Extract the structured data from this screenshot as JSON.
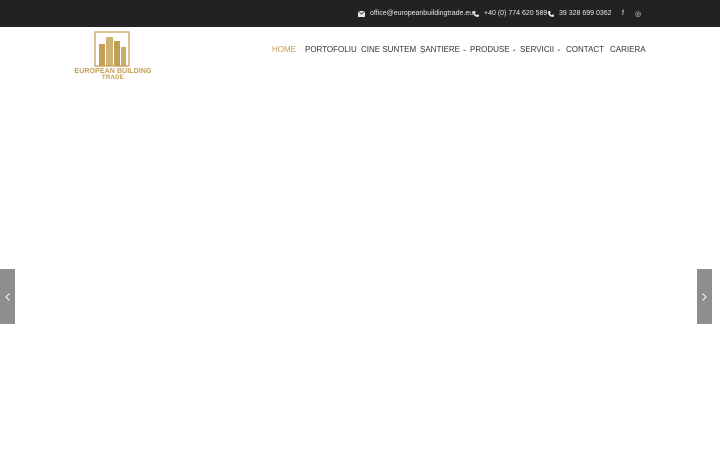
{
  "topbar": {
    "email": "office@europeanbuildingtrade.eu",
    "phone1": "+40 (0) 774 620 589",
    "phone2": "39 328 699 0362",
    "social": [
      {
        "icon": "facebook-icon",
        "glyph": "f"
      },
      {
        "icon": "instagram-icon",
        "glyph": "◎"
      }
    ]
  },
  "logo": {
    "line1": "EUROPEAN BUILDING",
    "line2": "TRADE"
  },
  "nav": {
    "items": [
      {
        "label": "HOME",
        "active": true
      },
      {
        "label": "PORTOFOLIU"
      },
      {
        "label": "CINE SUNTEM"
      },
      {
        "label": "ȘANTIERE",
        "dropdown": true
      },
      {
        "label": "PRODUSE",
        "dropdown": true
      },
      {
        "label": "SERVICII",
        "dropdown": true
      },
      {
        "label": "CONTACT"
      },
      {
        "label": "CARIERA"
      }
    ]
  },
  "slider": {
    "prev_glyph": "‹",
    "next_glyph": "›"
  },
  "colors": {
    "topbar_bg": "#222222",
    "accent_gold": "#c29d52",
    "nav_text": "#333333",
    "arrow_bg": "#8e8e8e"
  }
}
